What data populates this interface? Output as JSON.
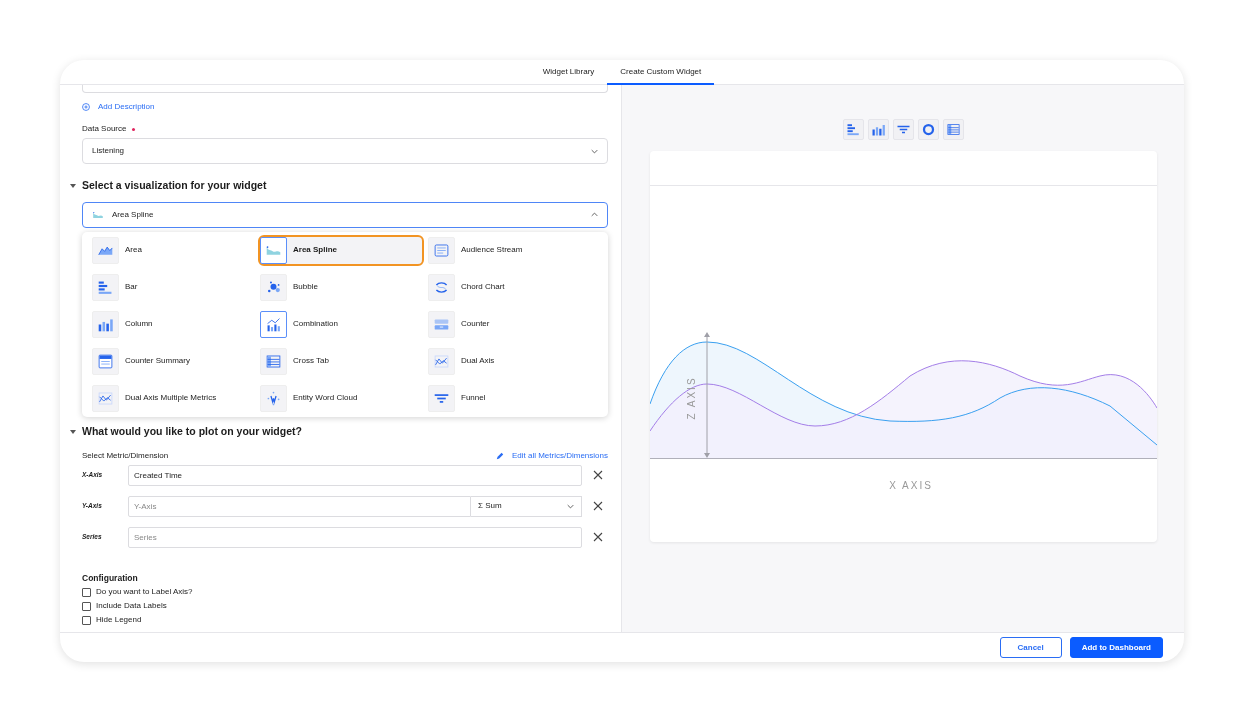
{
  "tabs": [
    {
      "label": "Widget Library",
      "selected": false
    },
    {
      "label": "Create Custom Widget",
      "selected": true
    }
  ],
  "details": {
    "add_description": "Add Description",
    "data_source": {
      "label": "Data Source",
      "required": true,
      "value": "Listening"
    }
  },
  "visualization": {
    "heading": "Select a visualization for your widget",
    "expanded": true,
    "value": "Area Spline",
    "options": [
      {
        "label": "Area",
        "kind": "area",
        "selected": false,
        "highlighted": false
      },
      {
        "label": "Area Spline",
        "kind": "areaspline",
        "selected": true,
        "highlighted": false
      },
      {
        "label": "Audience Stream",
        "kind": "stream",
        "selected": false,
        "highlighted": false
      },
      {
        "label": "Bar",
        "kind": "bar",
        "selected": false,
        "highlighted": false
      },
      {
        "label": "Bubble",
        "kind": "bubble",
        "selected": false,
        "highlighted": false
      },
      {
        "label": "Chord Chart",
        "kind": "chord",
        "selected": false,
        "highlighted": false
      },
      {
        "label": "Column",
        "kind": "column",
        "selected": false,
        "highlighted": false
      },
      {
        "label": "Combination",
        "kind": "combo",
        "selected": false,
        "highlighted": true
      },
      {
        "label": "Counter",
        "kind": "counter",
        "selected": false,
        "highlighted": false
      },
      {
        "label": "Counter Summary",
        "kind": "summary",
        "selected": false,
        "highlighted": false
      },
      {
        "label": "Cross Tab",
        "kind": "crosstab",
        "selected": false,
        "highlighted": false
      },
      {
        "label": "Dual Axis",
        "kind": "dual",
        "selected": false,
        "highlighted": false
      },
      {
        "label": "Dual Axis Multiple Metrics",
        "kind": "dualmulti",
        "selected": false,
        "highlighted": false
      },
      {
        "label": "Entity Word Cloud",
        "kind": "cloud",
        "selected": false,
        "highlighted": false
      },
      {
        "label": "Funnel",
        "kind": "funnel",
        "selected": false,
        "highlighted": false
      }
    ]
  },
  "plot": {
    "heading": "What would you like to plot on your widget?",
    "expanded": true,
    "label": "Select Metric/Dimension",
    "edit_link": "Edit all Metrics/Dimensions",
    "fields": [
      {
        "label": "X-Axis",
        "value": "Created Time"
      },
      {
        "label": "Y-Axis",
        "placeholder": "Y-Axis",
        "aggregation_symbol": "Σ",
        "aggregation": "Sum"
      },
      {
        "label": "Series",
        "placeholder": "Series"
      }
    ]
  },
  "configuration": {
    "heading": "Configuration",
    "options": [
      {
        "label": "Do you want to Label Axis?",
        "checked": false
      },
      {
        "label": "Include Data Labels",
        "checked": false
      },
      {
        "label": "Hide Legend",
        "checked": false
      }
    ]
  },
  "preview": {
    "chart_types": [
      {
        "kind": "bar"
      },
      {
        "kind": "column"
      },
      {
        "kind": "funnel"
      },
      {
        "kind": "donut"
      },
      {
        "kind": "crosstab"
      }
    ],
    "z_axis": "Z AXIS",
    "x_axis": "X AXIS"
  },
  "footer": {
    "buttons": [
      {
        "label": "Cancel",
        "kind": "outline"
      },
      {
        "label": "Add to Dashboard",
        "kind": "primary"
      }
    ]
  }
}
